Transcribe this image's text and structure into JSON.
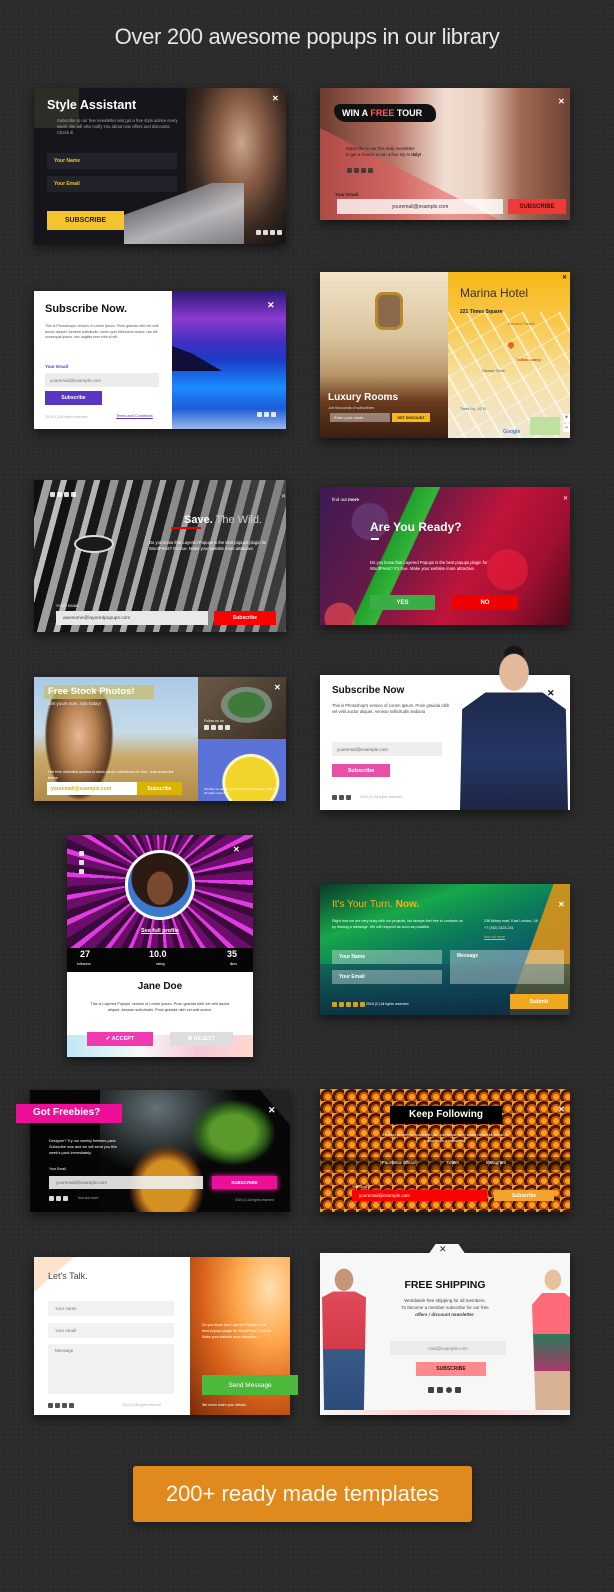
{
  "header": {
    "title": "Over 200 awesome popups in our library"
  },
  "popups": {
    "style_assistant": {
      "title": "Style Assistant",
      "body": "Subscribe to our free newsletter and get a free style advice every week. We will also notify You about new offers and discounts. Check it!",
      "name_placeholder": "Your Name",
      "email_placeholder": "Your Email",
      "button": "SUBSCRIBE",
      "close": "✕"
    },
    "win_tour": {
      "title_a": "WIN A ",
      "title_b": "FREE",
      "title_c": " TOUR",
      "body_a": "Subscribe to our free daily newsletter",
      "body_b": "to get a chance to win a free trip to ",
      "body_c": "Italy!",
      "email_label": "Your Email",
      "email_value": "youremail@example.com",
      "button": "SUBSCRIBE",
      "close": "✕"
    },
    "subscribe_now_purple": {
      "title": "Subscribe Now.",
      "body": "This is Photoshop's version of Lorem Ipsum. Proin gravida nibh vel velit auctor aliquet. Aenean sollicitudin, lorem quis bibendum auctor, nisi elit consequat ipsum, nec sagittis sem nibh id elit.",
      "email_label": "Your Email",
      "email_placeholder": "youremail@example.com",
      "button": "Subscribe",
      "copyright": "2016 (C) All rights reserved",
      "terms": "Terms and Conditions",
      "close": "✕"
    },
    "marina_hotel": {
      "title": "Marina Hotel",
      "address": "221 Times Square",
      "pin_label": "Таймс-сквер",
      "map_labels": [
        "Disney Store",
        "Times Sq - 42 St",
        "Garment Theatre"
      ],
      "rooms_title": "Luxury Rooms",
      "rooms_sub": "Join thousands of subscribers",
      "email_placeholder": "Enter your email...",
      "button": "GET DISCOUNT",
      "zoom_in": "+",
      "zoom_out": "−",
      "google": "Google",
      "close": "✕"
    },
    "save_wild": {
      "title_a": "Save.",
      "title_b": " The Wild.",
      "body": "Do you know that Layered Popups is the best popups plugin for WordPress? It's true. Make your website more attractive.",
      "email_label": "YOUR EMAIL",
      "email_value": "awesome@layeredpopups.com",
      "button": "Subscribe",
      "close": "✕"
    },
    "are_you_ready": {
      "find_a": "find out ",
      "find_b": "more",
      "title": "Are You Ready?",
      "body": "Do you know that Layered Popups is the best popups plugin for WordPress? It's true. Make your website more attractive.",
      "yes": "YES",
      "no": "NO",
      "close": "✕"
    },
    "stock_photos": {
      "title": "Free Stock Photos!",
      "subtitle": "Get yours now. Join today!",
      "body": "Get free unlimited access to stock photo collections for free. Just subscribe below",
      "follow": "Follow us on",
      "email_value": "youremail@example.com",
      "button": "Subscribe",
      "note": "Monthly we deliver your daily with 3rd parties. 2016 (C) All rights reserved",
      "close": "✕"
    },
    "subscribe_now_pink": {
      "title": "Subscribe Now",
      "body": "This is Photoshop's version of Lorem Ipsum. Proin gravida nibh vel velit auctor aliquet. Aenean sollicitudin,sediana",
      "email_placeholder": "youremail@example.com",
      "button": "Subscribe",
      "copyright": "2016 (C) All rights reserved",
      "close": "✕"
    },
    "profile": {
      "see_profile": "See full profile",
      "stats": [
        {
          "value": "27",
          "label": "followers"
        },
        {
          "value": "10.0",
          "label": "rating"
        },
        {
          "value": "35",
          "label": "likes"
        }
      ],
      "name": "Jane Doe",
      "body": "This is Layered Popups' version of Lorem Ipsum. Proin gravida nibh vel velit auctor aliquet. Aenean sollicitudin. Proin gravida nibh vel velit auctor.",
      "accept": "✔ ACCEPT",
      "reject": "✖ REJECT",
      "close": "✕"
    },
    "your_turn": {
      "title_a": "It's Your Turn. ",
      "title_b": "Now.",
      "body": "Right now we are very busy with our projects, but always feel free to contacts us by leaving a message. We will respond as soon as possible.",
      "address": "238 Abbey road, East London, UK",
      "phone": "+7 (762) 3123-231",
      "findmore": "find out more",
      "name_placeholder": "Your Name",
      "email_placeholder": "Your Email",
      "message_placeholder": "Message",
      "button": "Submit",
      "copyright": "2016 (C) All rights reserved",
      "close": "✕"
    },
    "freebies": {
      "title": "Got Freebies?",
      "body": "Designer? Try our weekly freebies pack. Subscribe now and we will send you this week's pack immediately.",
      "email_label": "Your Email",
      "email_value": "youremail@example.com",
      "button": "SUBSCRIBE",
      "findmore": "find out more",
      "copyright": "2016 (C) All rights reserved",
      "close": "✕"
    },
    "keep_following": {
      "title": "Keep Following",
      "body": "It's easy to keep in touch with us! Just follow us in social networks below or subscribe to a newsletter.",
      "facebook": "Facebook official",
      "twitter": "Twitter",
      "instagram": "Instagram",
      "email_label": "Your Email",
      "email_value": "youremail@example.com",
      "button": "Subscribe",
      "close": "✕"
    },
    "lets_talk": {
      "title": "Let's Talk.",
      "name_placeholder": "Your name",
      "email_placeholder": "Your email",
      "message_placeholder": "Message",
      "body": "Do you know that Layered Popups is the best popups plugin for WordPress? It's true. Make your website more attractive.",
      "button": "Send Message",
      "note": "We never share your details.",
      "copyright": "2016 (C) All rights reserved",
      "close": "✕"
    },
    "free_shipping": {
      "title": "FREE SHIPPING",
      "body_a": "Worldwide free shipping for all members.",
      "body_b": "To become a member subscribe for our free",
      "body_c": "offers / discount newsletter",
      "body_d": ".",
      "email_placeholder": "mail@example.com",
      "button": "SUBSCRIBE",
      "close": "✕"
    }
  },
  "cta": {
    "label": "200+ ready made templates"
  }
}
